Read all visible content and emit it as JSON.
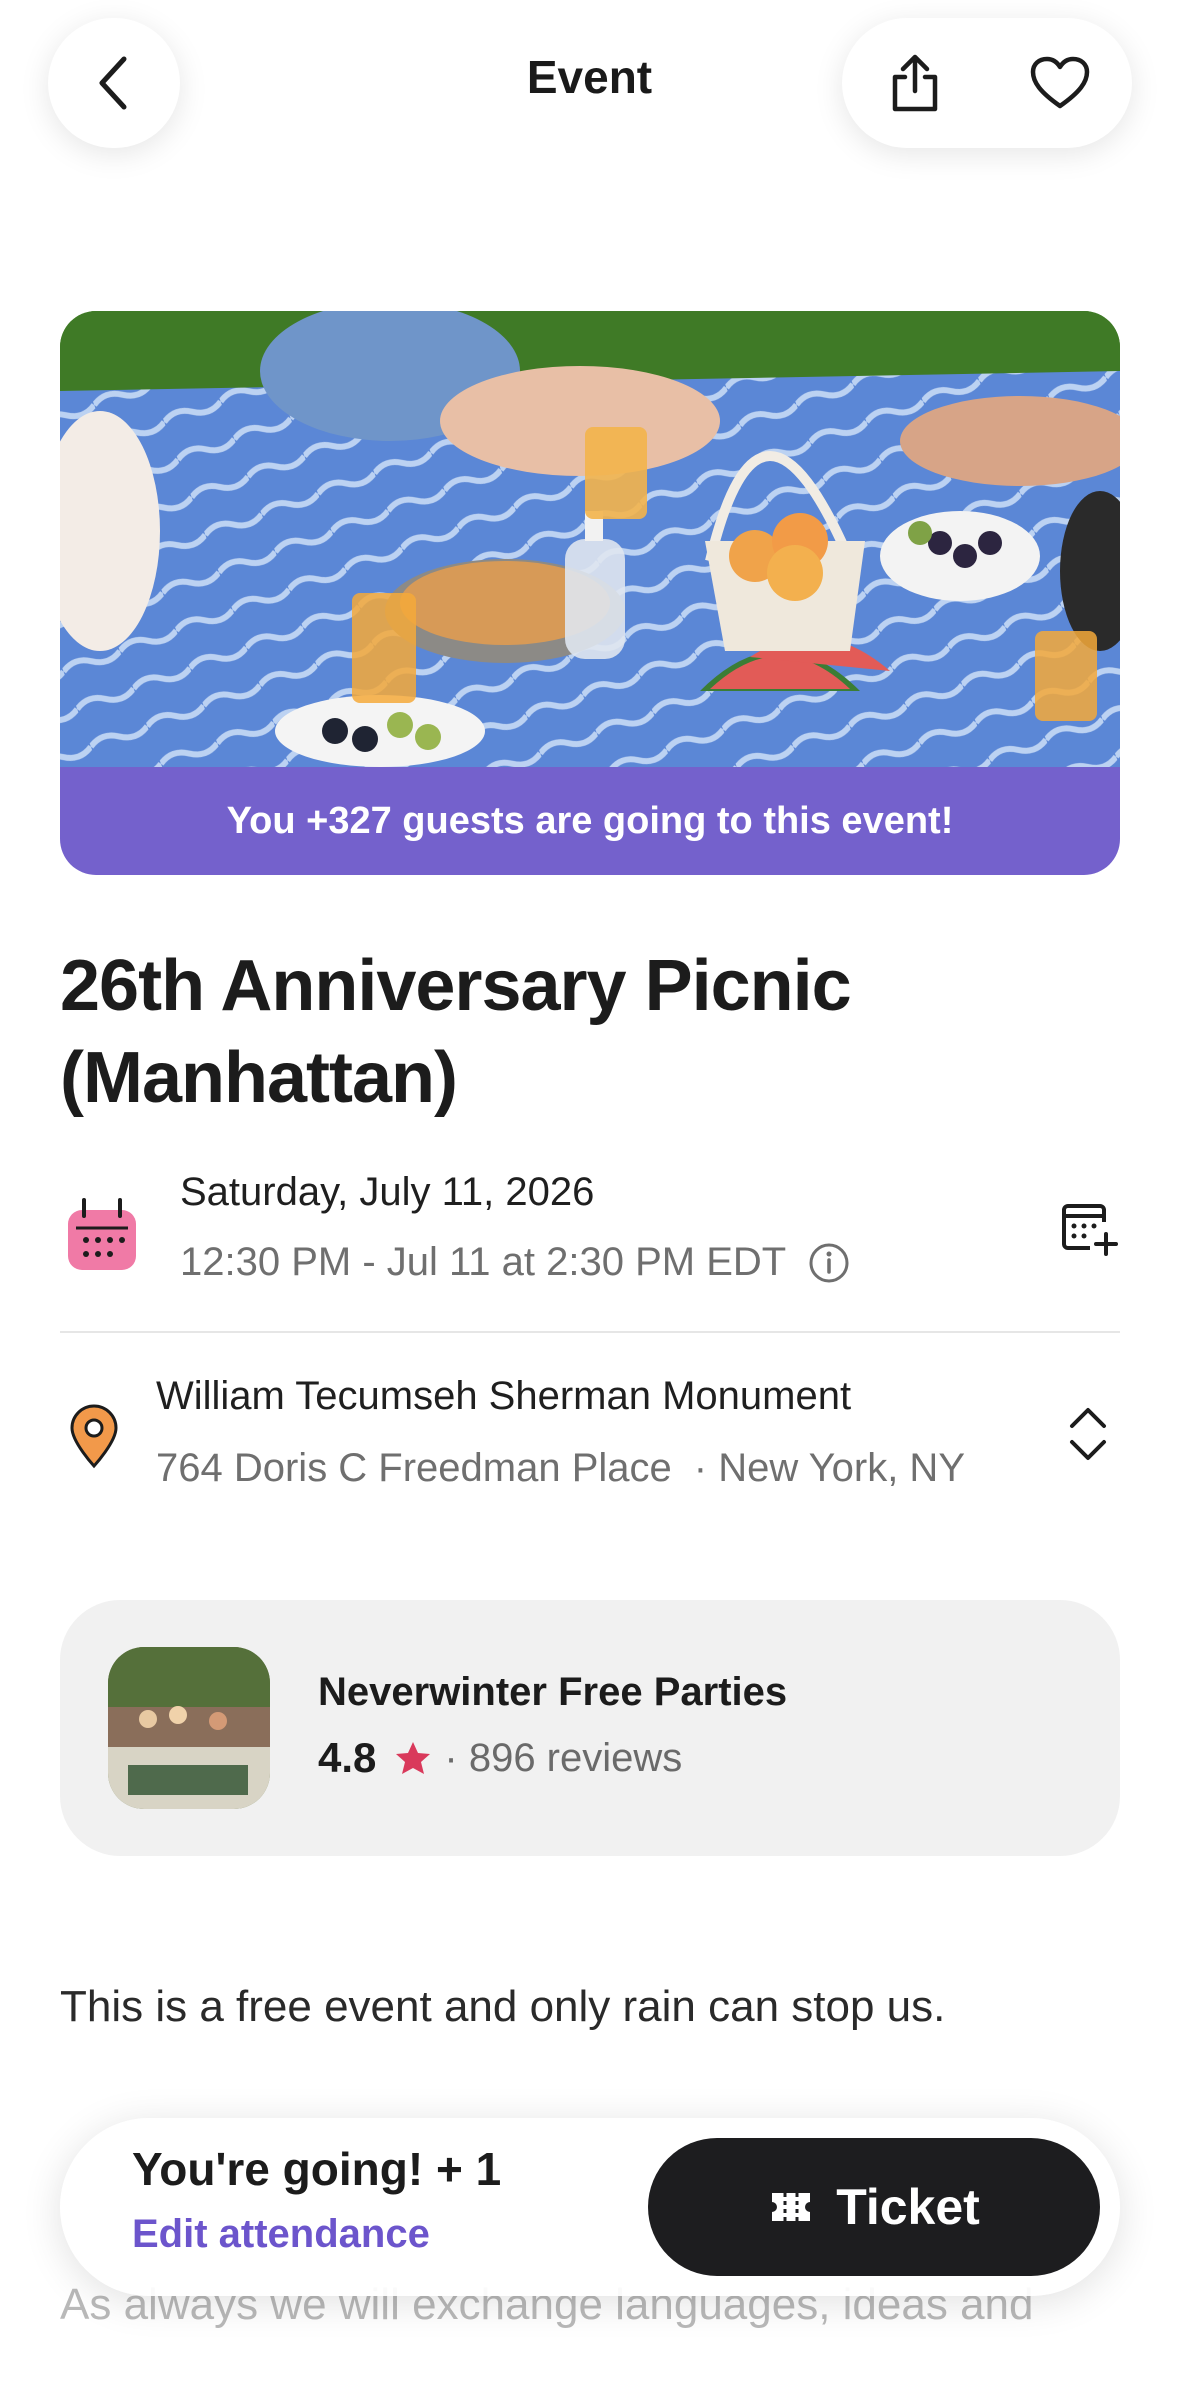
{
  "header": {
    "title": "Event"
  },
  "hero": {
    "guests_banner": "You +327 guests are going to this event!"
  },
  "event": {
    "title_line1": "26th Anniversary Picnic",
    "title_line2": "(Manhattan)",
    "date": "Saturday, July 11, 2026",
    "time": "12:30 PM - Jul 11 at 2:30 PM EDT",
    "location_name": "William Tecumseh Sherman Monument",
    "address": "764 Doris C Freedman Place",
    "city": "· New York, NY",
    "description": "This is a free event and only rain can stop us.",
    "faded_text": "As always we will exchange languages, ideas and"
  },
  "organizer": {
    "name": "Neverwinter Free Parties",
    "rating": "4.8",
    "reviews": "· 896 reviews"
  },
  "bottom_bar": {
    "status": "You're going! + 1",
    "edit_label": "Edit attendance",
    "ticket_label": "Ticket"
  },
  "colors": {
    "accent": "#7461cc",
    "link": "#6c55cc",
    "star": "#d9395b",
    "calendar_icon": "#f07aa6",
    "pin_icon": "#f2994a"
  }
}
